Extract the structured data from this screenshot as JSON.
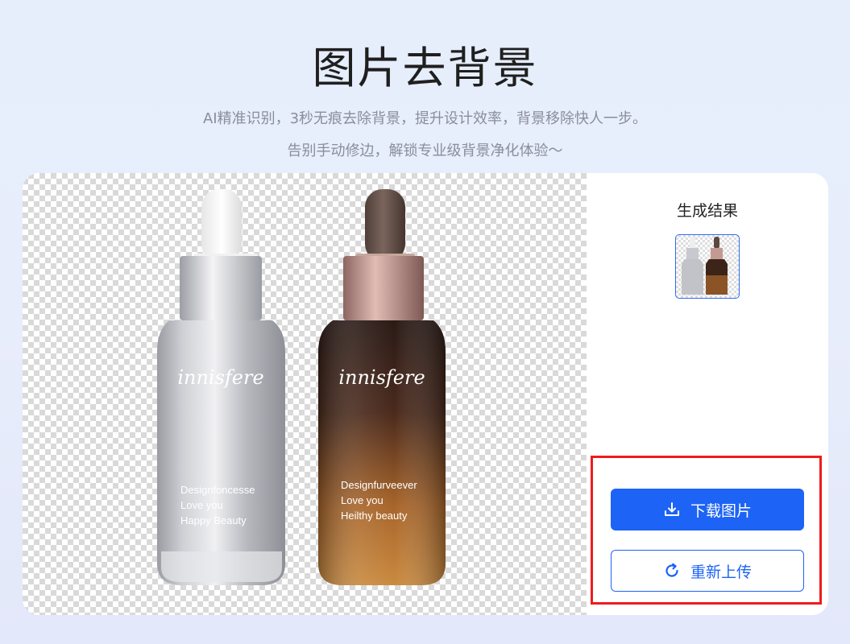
{
  "header": {
    "title": "图片去背景",
    "subtitle_line1": "AI精准识别，3秒无痕去除背景，提升设计效率，背景移除快人一步。",
    "subtitle_line2": "告别手动修边，解锁专业级背景净化体验～"
  },
  "preview": {
    "bottle_left": {
      "brand": "innisfere",
      "line1": "Designfoncesse",
      "line2": "Love you",
      "line3": "Happy Beauty"
    },
    "bottle_right": {
      "brand": "innisfere",
      "line1": "Designfurveever",
      "line2": "Love you",
      "line3": "Heilthy beauty"
    }
  },
  "panel": {
    "result_title": "生成结果",
    "download_label": "下载图片",
    "reupload_label": "重新上传"
  },
  "colors": {
    "accent": "#1d63f5",
    "highlight": "#ee1c1c"
  },
  "icons": {
    "download": "download-icon",
    "reupload": "refresh-icon"
  }
}
